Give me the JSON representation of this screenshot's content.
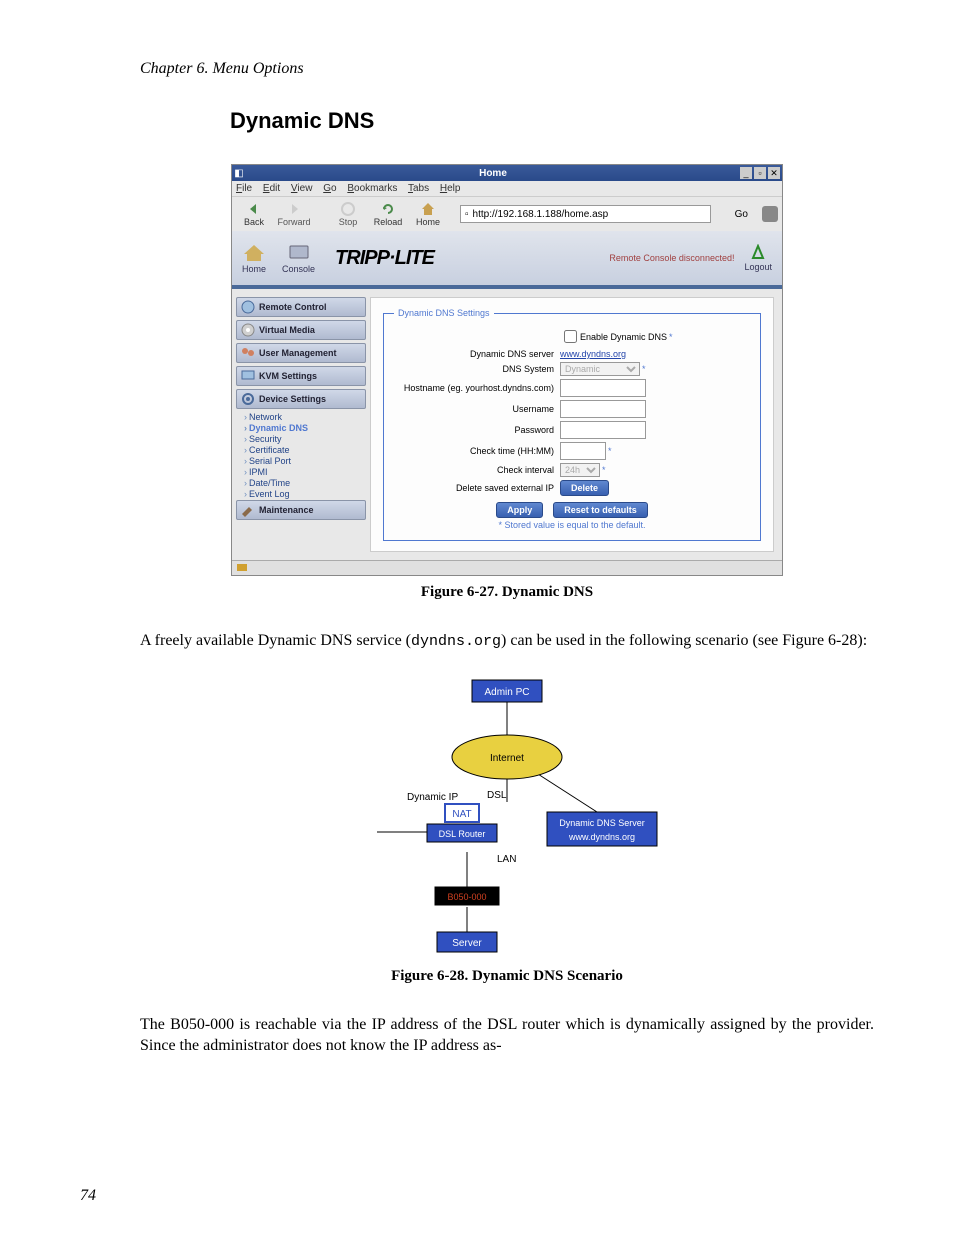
{
  "chapter_header": "Chapter 6. Menu Options",
  "section_title": "Dynamic DNS",
  "browser": {
    "title": "Home",
    "menus": [
      "File",
      "Edit",
      "View",
      "Go",
      "Bookmarks",
      "Tabs",
      "Help"
    ],
    "toolbar": {
      "back": "Back",
      "forward": "Forward",
      "stop": "Stop",
      "reload": "Reload",
      "home": "Home",
      "go": "Go"
    },
    "url": "http://192.168.1.188/home.asp"
  },
  "app": {
    "header_links": {
      "home": "Home",
      "console": "Console"
    },
    "logo": "TRIPP·LITE",
    "status": "Remote Console disconnected!",
    "logout": "Logout",
    "sidebar": {
      "items": [
        {
          "label": "Remote Control"
        },
        {
          "label": "Virtual Media"
        },
        {
          "label": "User Management"
        },
        {
          "label": "KVM Settings"
        },
        {
          "label": "Device Settings"
        },
        {
          "label": "Maintenance"
        }
      ],
      "subitems": [
        "Network",
        "Dynamic DNS",
        "Security",
        "Certificate",
        "Serial Port",
        "IPMI",
        "Date/Time",
        "Event Log"
      ]
    },
    "fieldset_legend": "Dynamic DNS Settings",
    "form": {
      "enable_label": "Enable Dynamic DNS",
      "server_label": "Dynamic DNS server",
      "server_link": "www.dyndns.org",
      "system_label": "DNS System",
      "system_option": "Dynamic",
      "hostname_label": "Hostname (eg. yourhost.dyndns.com)",
      "username_label": "Username",
      "password_label": "Password",
      "checktime_label": "Check time (HH:MM)",
      "interval_label": "Check interval",
      "interval_option": "24h",
      "delete_label": "Delete saved external IP",
      "delete_btn": "Delete",
      "apply_btn": "Apply",
      "reset_btn": "Reset to defaults",
      "stored_note": "* Stored value is equal to the default."
    }
  },
  "fig27_caption": "Figure 6-27. Dynamic DNS",
  "body1_pre": "A freely available Dynamic DNS service (",
  "body1_code": "dyndns.org",
  "body1_post": ") can be used in the following scenario (see Figure 6-28):",
  "diagram": {
    "admin": "Admin PC",
    "internet": "Internet",
    "dyn_ip": "Dynamic IP",
    "dsl": "DSL",
    "nat": "NAT",
    "router": "DSL Router",
    "lan": "LAN",
    "dns_server": "Dynamic DNS Server",
    "dns_url": "www.dyndns.org",
    "device": "B050-000",
    "server": "Server"
  },
  "fig28_caption": "Figure 6-28. Dynamic DNS Scenario",
  "body2": "The B050-000 is reachable via the IP address of the DSL router which is dynamically assigned by the provider. Since the administrator does not know the IP address as-",
  "page_number": "74"
}
